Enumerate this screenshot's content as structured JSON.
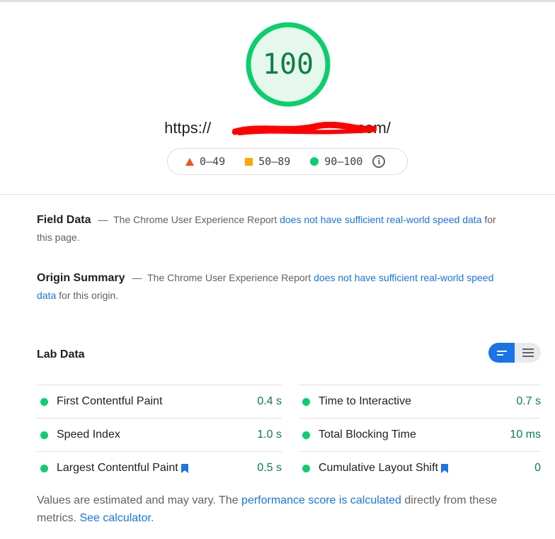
{
  "header": {
    "score": "100",
    "score_value": 100,
    "url_prefix": "https://",
    "url_suffix": ".com/"
  },
  "legend": {
    "fail_range": "0–49",
    "average_range": "50–89",
    "pass_range": "90–100"
  },
  "field_data": {
    "title": "Field Data",
    "dash": "—",
    "text_before": "The Chrome User Experience Report",
    "link": "does not have sufficient real-world speed data",
    "text_after": "for this page."
  },
  "origin_summary": {
    "title": "Origin Summary",
    "dash": "—",
    "text_before": "The Chrome User Experience Report",
    "link": "does not have sufficient real-world speed data",
    "text_after": "for this origin."
  },
  "lab_data": {
    "title": "Lab Data",
    "metrics": [
      {
        "label": "First Contentful Paint",
        "value": "0.4 s",
        "bookmark": false
      },
      {
        "label": "Time to Interactive",
        "value": "0.7 s",
        "bookmark": false
      },
      {
        "label": "Speed Index",
        "value": "1.0 s",
        "bookmark": false
      },
      {
        "label": "Total Blocking Time",
        "value": "10 ms",
        "bookmark": false
      },
      {
        "label": "Largest Contentful Paint",
        "value": "0.5 s",
        "bookmark": true
      },
      {
        "label": "Cumulative Layout Shift",
        "value": "0",
        "bookmark": true
      }
    ]
  },
  "footer": {
    "text1": "Values are estimated and may vary. The",
    "link1": "performance score is calculated",
    "text2": "directly from these metrics.",
    "link2": "See calculator."
  },
  "colors": {
    "pass_green": "#0cce6b",
    "pass_text": "#0b8043",
    "gauge_fill": "#e6f7ee",
    "fail_red": "#f4511e",
    "average_orange": "#ffa400",
    "link_blue": "#1a73e8",
    "redaction_red": "#ff0000"
  }
}
